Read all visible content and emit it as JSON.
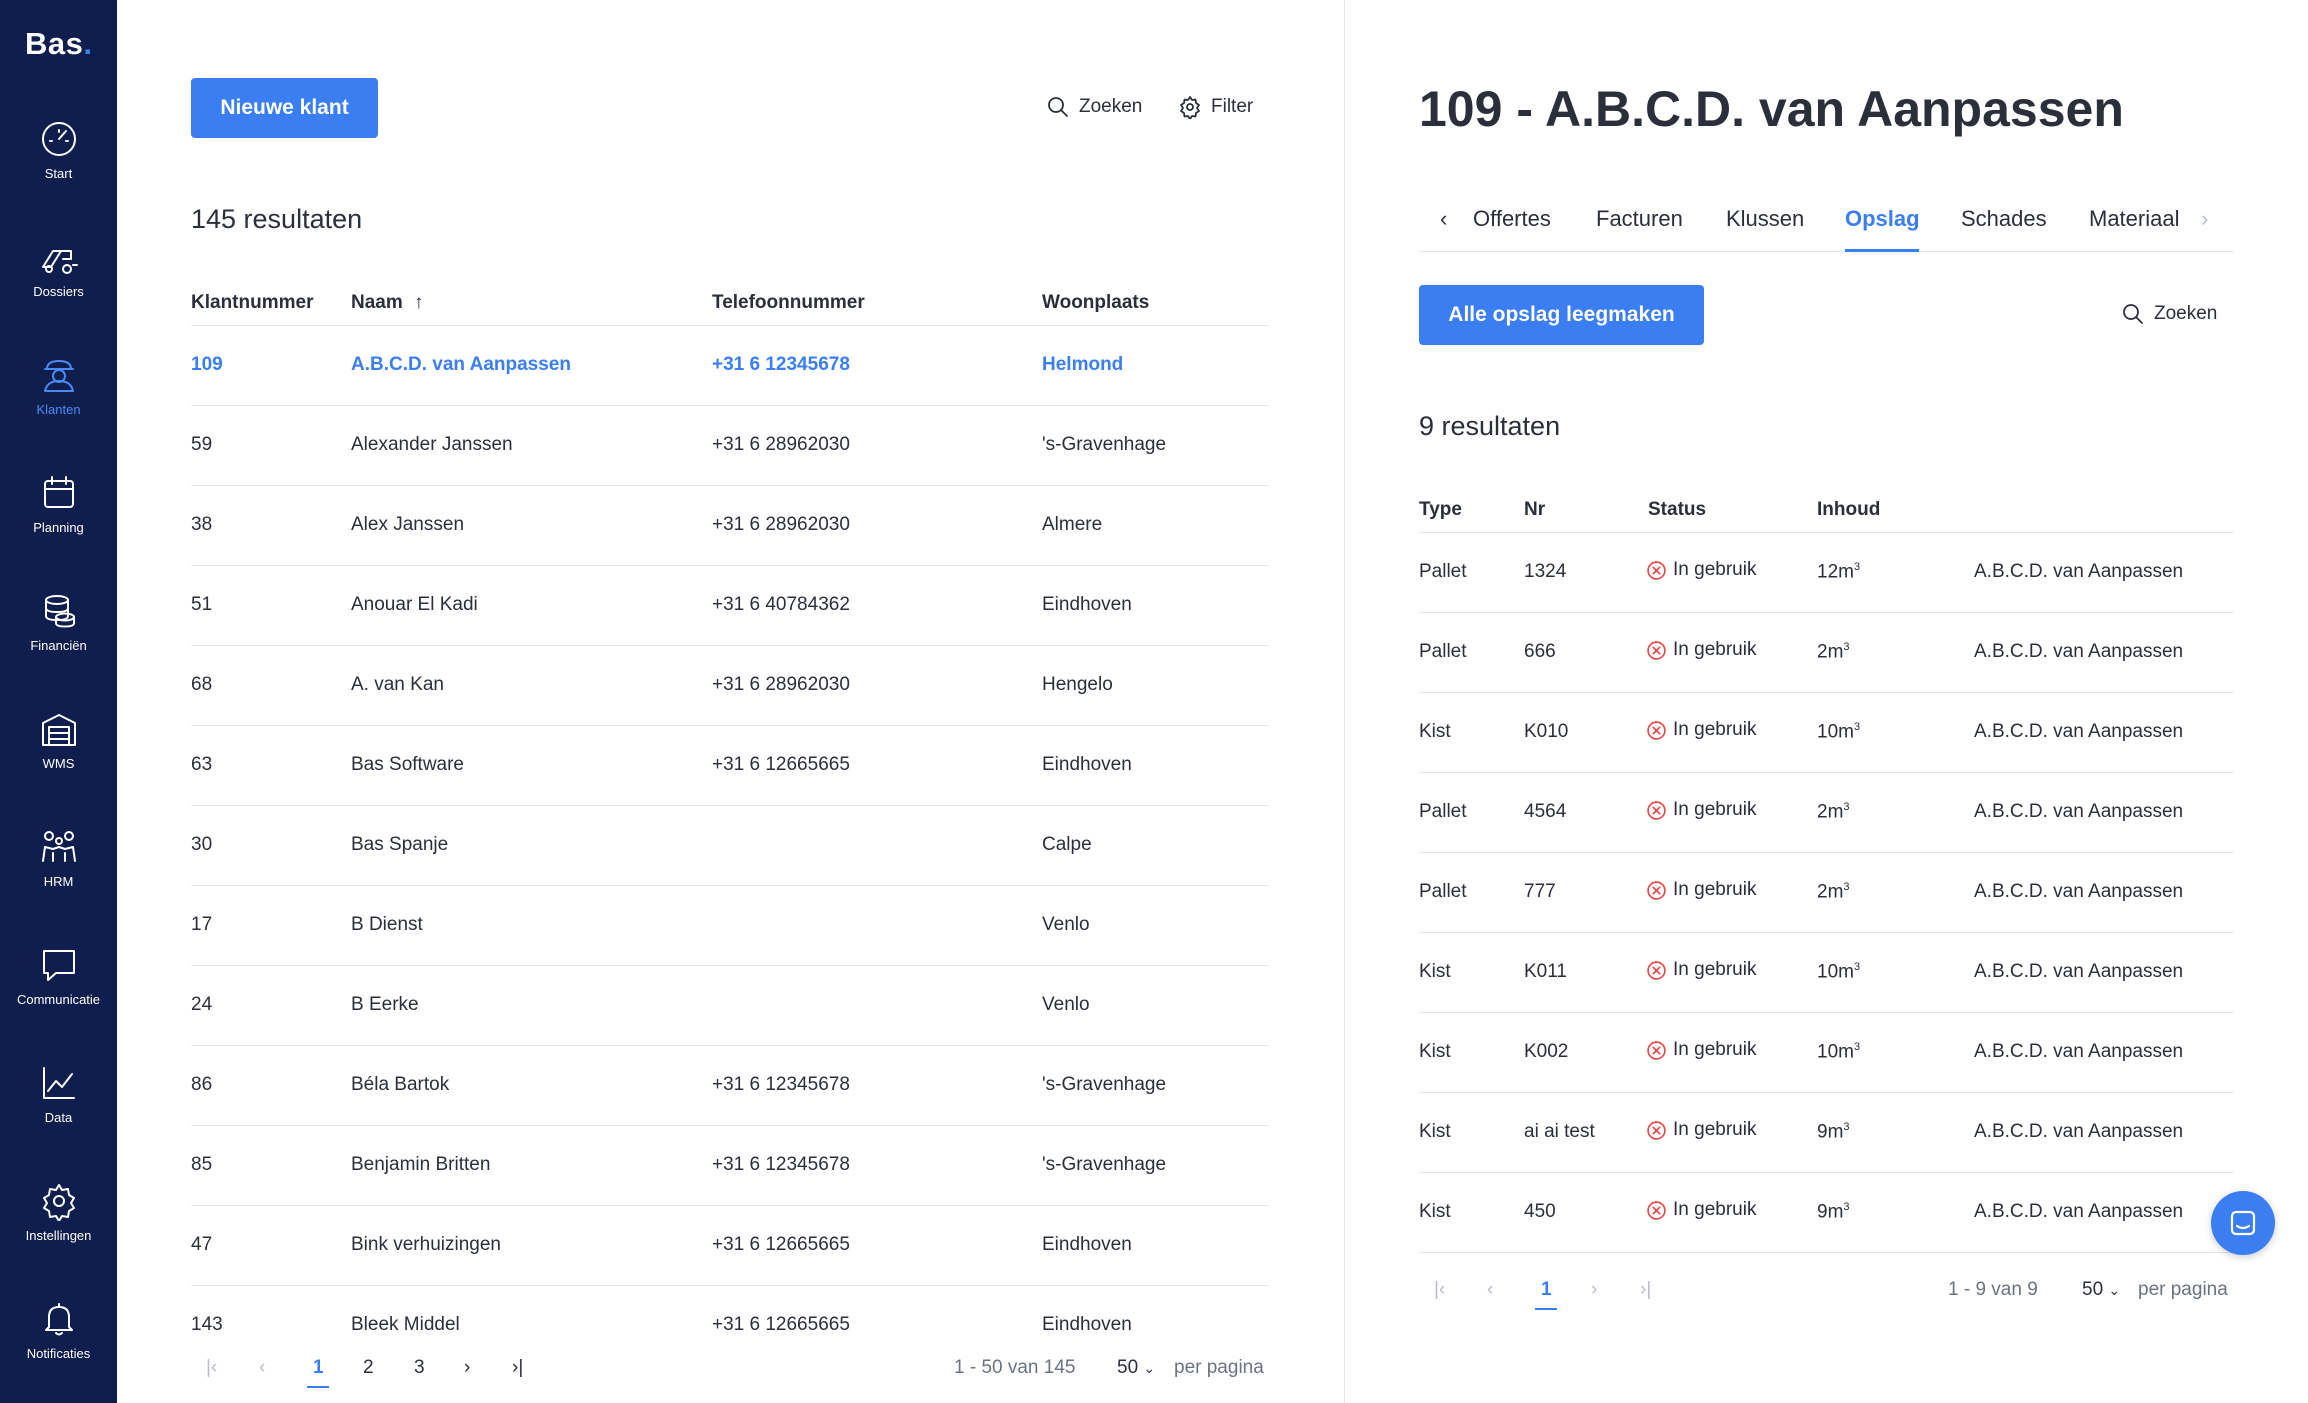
{
  "app": {
    "logo": "Bas",
    "logo_dot": "."
  },
  "sidebar": {
    "items": [
      {
        "label": "Start",
        "icon": "speedometer-icon"
      },
      {
        "label": "Dossiers",
        "icon": "truck-icon"
      },
      {
        "label": "Klanten",
        "icon": "customers-icon",
        "active": true
      },
      {
        "label": "Planning",
        "icon": "calendar-icon"
      },
      {
        "label": "Financiën",
        "icon": "coins-icon"
      },
      {
        "label": "WMS",
        "icon": "warehouse-icon"
      },
      {
        "label": "HRM",
        "icon": "people-icon"
      },
      {
        "label": "Communicatie",
        "icon": "chat-icon"
      },
      {
        "label": "Data",
        "icon": "line-chart-icon"
      },
      {
        "label": "Instellingen",
        "icon": "gear-icon"
      },
      {
        "label": "Notificaties",
        "icon": "bell-icon"
      }
    ]
  },
  "left": {
    "new_button": "Nieuwe klant",
    "search_label": "Zoeken",
    "filter_label": "Filter",
    "results": "145 resultaten",
    "columns": [
      "Klantnummer",
      "Naam",
      "Telefoonnummer",
      "Woonplaats"
    ],
    "sort_indicator": "↑",
    "rows": [
      [
        "109",
        "A.B.C.D. van Aanpassen",
        "+31 6 12345678",
        "Helmond"
      ],
      [
        "59",
        "Alexander Janssen",
        "+31 6 28962030",
        "'s-Gravenhage"
      ],
      [
        "38",
        "Alex Janssen",
        "+31 6 28962030",
        "Almere"
      ],
      [
        "51",
        "Anouar El Kadi",
        "+31 6 40784362",
        "Eindhoven"
      ],
      [
        "68",
        "A. van Kan",
        "+31 6 28962030",
        "Hengelo"
      ],
      [
        "63",
        "Bas Software",
        "+31 6 12665665",
        "Eindhoven"
      ],
      [
        "30",
        "Bas Spanje",
        "",
        "Calpe"
      ],
      [
        "17",
        "B Dienst",
        "",
        "Venlo"
      ],
      [
        "24",
        "B Eerke",
        "",
        "Venlo"
      ],
      [
        "86",
        "Béla Bartok",
        "+31 6 12345678",
        "'s-Gravenhage"
      ],
      [
        "85",
        "Benjamin Britten",
        "+31 6 12345678",
        "'s-Gravenhage"
      ],
      [
        "47",
        "Bink verhuizingen",
        "+31 6 12665665",
        "Eindhoven"
      ],
      [
        "143",
        "Bleek Middel",
        "+31 6 12665665",
        "Eindhoven"
      ]
    ],
    "pagination": {
      "pages": [
        "1",
        "2",
        "3"
      ],
      "current": "1",
      "range": "1 - 50 van 145",
      "per_page": "50",
      "per_page_label": "per pagina"
    }
  },
  "right": {
    "title": "109 - A.B.C.D. van Aanpassen",
    "tabs": [
      "Offertes",
      "Facturen",
      "Klussen",
      "Opslag",
      "Schades",
      "Materiaal"
    ],
    "active_tab": "Opslag",
    "clear_button": "Alle opslag leegmaken",
    "search_label": "Zoeken",
    "results": "9 resultaten",
    "columns": [
      "Type",
      "Nr",
      "Status",
      "Inhoud"
    ],
    "rows": [
      [
        "Pallet",
        "1324",
        "In gebruik",
        "12",
        "A.B.C.D. van Aanpassen"
      ],
      [
        "Pallet",
        "666",
        "In gebruik",
        "2",
        "A.B.C.D. van Aanpassen"
      ],
      [
        "Kist",
        "K010",
        "In gebruik",
        "10",
        "A.B.C.D. van Aanpassen"
      ],
      [
        "Pallet",
        "4564",
        "In gebruik",
        "2",
        "A.B.C.D. van Aanpassen"
      ],
      [
        "Pallet",
        "777",
        "In gebruik",
        "2",
        "A.B.C.D. van Aanpassen"
      ],
      [
        "Kist",
        "K011",
        "In gebruik",
        "10",
        "A.B.C.D. van Aanpassen"
      ],
      [
        "Kist",
        "K002",
        "In gebruik",
        "10",
        "A.B.C.D. van Aanpassen"
      ],
      [
        "Kist",
        "ai ai test",
        "In gebruik",
        "9",
        "A.B.C.D. van Aanpassen"
      ],
      [
        "Kist",
        "450",
        "In gebruik",
        "9",
        "A.B.C.D. van Aanpassen"
      ]
    ],
    "unit": "m",
    "unit_sup": "3",
    "pagination": {
      "current": "1",
      "range": "1 - 9 van 9",
      "per_page": "50",
      "per_page_label": "per pagina"
    }
  },
  "colors": {
    "sidebar_bg": "#0f1e4d",
    "accent": "#3b7ef2",
    "status_red": "#e5484d"
  }
}
